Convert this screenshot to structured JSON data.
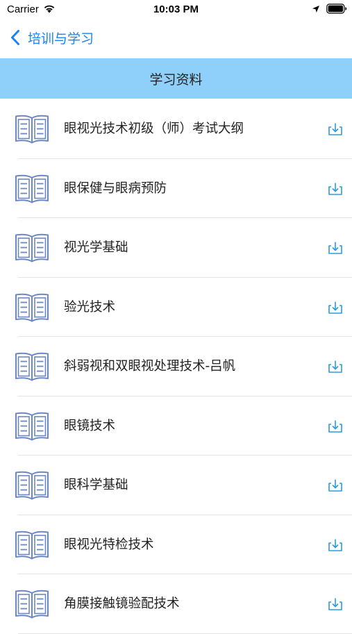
{
  "status_bar": {
    "carrier": "Carrier",
    "time": "10:03 PM"
  },
  "nav": {
    "back_label": "培训与学习",
    "accent_color": "#1a82fb"
  },
  "section": {
    "title": "学习资料",
    "background_color": "#8ed0f9"
  },
  "materials": {
    "icon": "book-icon",
    "action_icon": "download-icon",
    "items": [
      {
        "title": "眼视光技术初级（师）考试大纲"
      },
      {
        "title": "眼保健与眼病预防"
      },
      {
        "title": "视光学基础"
      },
      {
        "title": "验光技术"
      },
      {
        "title": "斜弱视和双眼视处理技术-吕帆"
      },
      {
        "title": "眼镜技术"
      },
      {
        "title": "眼科学基础"
      },
      {
        "title": "眼视光特检技术"
      },
      {
        "title": "角膜接触镜验配技术"
      }
    ]
  }
}
